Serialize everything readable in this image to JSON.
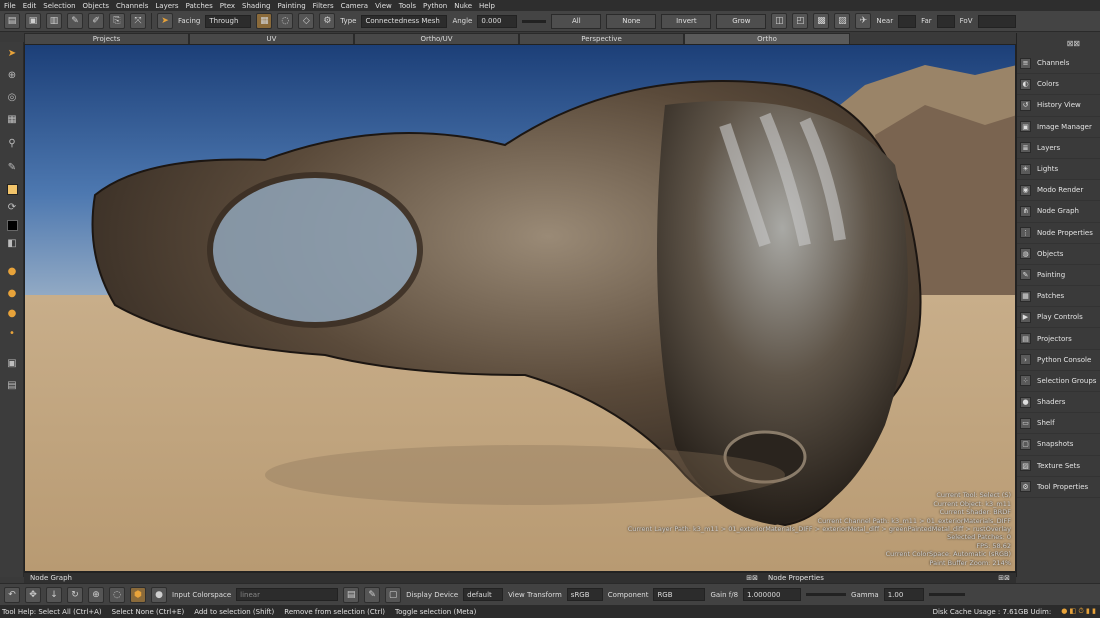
{
  "menu": [
    "File",
    "Edit",
    "Selection",
    "Objects",
    "Channels",
    "Layers",
    "Patches",
    "Ptex",
    "Shading",
    "Painting",
    "Filters",
    "Camera",
    "View",
    "Tools",
    "Python",
    "Nuke",
    "Help"
  ],
  "toolbar": {
    "facing_label": "Facing",
    "facing_value": "Through",
    "type_label": "Type",
    "type_value": "Connectedness Mesh",
    "angle_label": "Angle",
    "angle_value": "0.000",
    "all": "All",
    "none": "None",
    "invert": "Invert",
    "grow": "Grow",
    "near_label": "Near",
    "far_label": "Far",
    "fov_label": "FoV"
  },
  "tabs": [
    "Projects",
    "UV",
    "Ortho/UV",
    "Perspective",
    "Ortho"
  ],
  "right_panel": {
    "items": [
      {
        "label": "Channels",
        "icon": "channels-icon"
      },
      {
        "label": "Colors",
        "icon": "colors-icon"
      },
      {
        "label": "History View",
        "icon": "history-icon"
      },
      {
        "label": "Image Manager",
        "icon": "image-manager-icon"
      },
      {
        "label": "Layers",
        "icon": "layers-icon"
      },
      {
        "label": "Lights",
        "icon": "lights-icon"
      },
      {
        "label": "Modo Render",
        "icon": "modo-render-icon"
      },
      {
        "label": "Node Graph",
        "icon": "node-graph-icon"
      },
      {
        "label": "Node Properties",
        "icon": "node-properties-icon"
      },
      {
        "label": "Objects",
        "icon": "objects-icon"
      },
      {
        "label": "Painting",
        "icon": "painting-icon"
      },
      {
        "label": "Patches",
        "icon": "patches-icon"
      },
      {
        "label": "Play Controls",
        "icon": "play-controls-icon"
      },
      {
        "label": "Projectors",
        "icon": "projectors-icon"
      },
      {
        "label": "Python Console",
        "icon": "python-console-icon"
      },
      {
        "label": "Selection Groups",
        "icon": "selection-groups-icon"
      },
      {
        "label": "Shaders",
        "icon": "shaders-icon"
      },
      {
        "label": "Shelf",
        "icon": "shelf-icon"
      },
      {
        "label": "Snapshots",
        "icon": "snapshots-icon"
      },
      {
        "label": "Texture Sets",
        "icon": "texture-sets-icon"
      },
      {
        "label": "Tool Properties",
        "icon": "tool-properties-icon"
      }
    ]
  },
  "hud": [
    "Current Tool: Select (S)",
    "Current Object: k3_m11",
    "Current Shader: BRDF",
    "Current Channel Path: k3_m11 > 01_exteriorMaterials_DIFF",
    "Current Layer Path: k3_m11 > 01_exteriorMaterials_DIFF > exteriorMetal_diff > greenPaintedMetal_diff > rustOverlay",
    "Selected Patches: 0",
    "FPS: 58.62",
    "Current ColorSpace: Automatic (sRGB)",
    "Paint Buffer Zoom: 214%"
  ],
  "panels": {
    "node_graph": "Node Graph",
    "node_properties": "Node Properties"
  },
  "bottom": {
    "input_colorspace_label": "Input Colorspace",
    "input_colorspace_value": "linear",
    "display_device_label": "Display Device",
    "display_device_value": "default",
    "view_transform_label": "View Transform",
    "view_transform_value": "sRGB",
    "component_label": "Component",
    "component_value": "RGB",
    "gain_label": "Gain f/8",
    "gain_value": "1.000000",
    "gamma_label": "Gamma",
    "gamma_value": "1.00"
  },
  "status": {
    "tool_help": "Tool Help: Select All (Ctrl+A)",
    "select_none": "Select None (Ctrl+E)",
    "add": "Add to selection (Shift)",
    "remove": "Remove from selection (Ctrl)",
    "toggle": "Toggle selection (Meta)",
    "disk": "Disk Cache Usage : 7.61GB Udim:"
  },
  "colors": {
    "accent": "#e8a33a",
    "selected": "#8a6a3a"
  }
}
